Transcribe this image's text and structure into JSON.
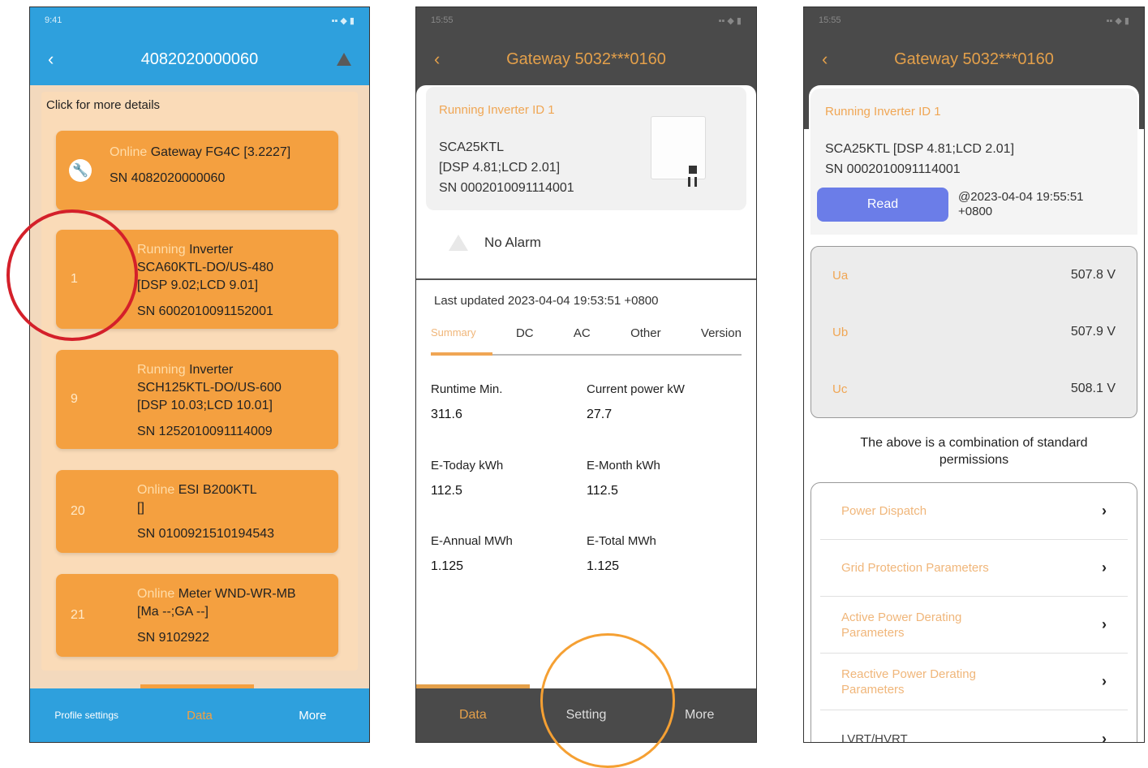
{
  "screen1": {
    "title": "4082020000060",
    "hint": "Click for more details",
    "devices": [
      {
        "idx": "",
        "status": "Online",
        "name": "Gateway FG4C [3.2227]",
        "lines": [],
        "sn": "SN 4082020000060"
      },
      {
        "idx": "1",
        "status": "Running",
        "name": "Inverter",
        "lines": [
          "SCA60KTL-DO/US-480",
          "[DSP 9.02;LCD 9.01]"
        ],
        "sn": "SN 6002010091152001"
      },
      {
        "idx": "9",
        "status": "Running",
        "name": "Inverter",
        "lines": [
          "SCH125KTL-DO/US-600",
          "[DSP 10.03;LCD 10.01]"
        ],
        "sn": "SN 1252010091114009"
      },
      {
        "idx": "20",
        "status": "Online",
        "name": "ESI B200KTL",
        "lines": [
          "[]"
        ],
        "sn": "SN 0100921510194543"
      },
      {
        "idx": "21",
        "status": "Online",
        "name": "Meter WND-WR-MB",
        "lines": [
          "[Ma --;GA --]"
        ],
        "sn": "SN 9102922"
      }
    ],
    "tabs": [
      "Profile settings",
      "Data",
      "More"
    ]
  },
  "screen2": {
    "title": "Gateway 5032***0160",
    "inverter_label": "Running Inverter ID 1",
    "model": "SCA25KTL",
    "firmware": "[DSP 4.81;LCD 2.01]",
    "sn": "SN 0002010091114001",
    "alarm": "No Alarm",
    "last_updated": "Last updated 2023-04-04 19:53:51 +0800",
    "subtabs": [
      "Summary",
      "DC",
      "AC",
      "Other",
      "Version"
    ],
    "metrics": [
      {
        "label": "Runtime Min.",
        "value": "311.6"
      },
      {
        "label": "Current power kW",
        "value": "27.7"
      },
      {
        "label": "E-Today kWh",
        "value": "112.5"
      },
      {
        "label": "E-Month kWh",
        "value": "112.5"
      },
      {
        "label": "E-Annual MWh",
        "value": "1.125"
      },
      {
        "label": "E-Total MWh",
        "value": "1.125"
      }
    ],
    "tabs": [
      "Data",
      "Setting",
      "More"
    ]
  },
  "screen3": {
    "title": "Gateway 5032***0160",
    "inverter_label": "Running Inverter ID 1",
    "model": "SCA25KTL [DSP 4.81;LCD 2.01]",
    "sn": "SN 0002010091114001",
    "read_label": "Read",
    "read_time_1": "@2023-04-04 19:55:51",
    "read_time_2": "+0800",
    "measurements": [
      {
        "label": "Ua",
        "value": "507.8 V"
      },
      {
        "label": "Ub",
        "value": "507.9 V"
      },
      {
        "label": "Uc",
        "value": "508.1 V"
      }
    ],
    "note_1": "The above is a combination of standard",
    "note_2": "permissions",
    "menu": [
      {
        "line1": "Power Dispatch",
        "line2": ""
      },
      {
        "line1": "Grid Protection Parameters",
        "line2": ""
      },
      {
        "line1": "Active Power Derating",
        "line2": "Parameters"
      },
      {
        "line1": "Reactive Power Derating",
        "line2": "Parameters"
      },
      {
        "line1": "LVRT/HVRT",
        "line2": ""
      }
    ]
  },
  "colors": {
    "blue": "#2ea0dd",
    "orange": "#f4a040",
    "dark": "#4a4a4a",
    "button": "#6b7de8",
    "red_circle": "#d4202a",
    "orange_circle": "#f5a033"
  }
}
